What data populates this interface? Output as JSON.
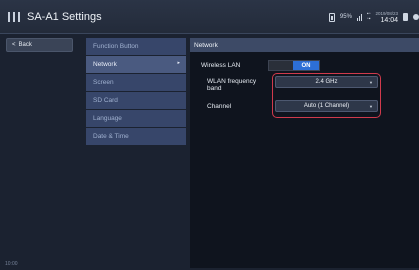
{
  "app": {
    "title": "SA-A1 Settings"
  },
  "status": {
    "battery_percent": "95%",
    "date": "2019/08/23",
    "time": "14:04",
    "icons": [
      "battery-icon",
      "signal-bars-icon",
      "network-status-icon",
      "sd-card-icon",
      "location-pin-icon"
    ]
  },
  "back_button": {
    "label": "Back",
    "icon": "chevron-left-icon"
  },
  "menu": {
    "items": [
      {
        "label": "Function Button",
        "active": false
      },
      {
        "label": "Network",
        "active": true
      },
      {
        "label": "Screen",
        "active": false
      },
      {
        "label": "SD Card",
        "active": false
      },
      {
        "label": "Language",
        "active": false
      },
      {
        "label": "Date & Time",
        "active": false
      }
    ]
  },
  "panel": {
    "title": "Network",
    "wireless_lan": {
      "label": "Wireless LAN",
      "value": "ON"
    },
    "band": {
      "label_line1": "WLAN frequency",
      "label_line2": "band",
      "value": "2.4 GHz"
    },
    "channel": {
      "label": "Channel",
      "value": "Auto (1 Channel)"
    }
  },
  "footer": {
    "time": "10:00"
  },
  "colors": {
    "highlight": "#d03a4c",
    "toggle_on": "#2d6fd6",
    "menu_bg": "#37466a"
  }
}
